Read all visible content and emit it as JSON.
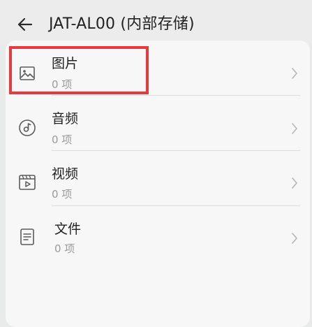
{
  "header": {
    "title": "JAT-AL00 (内部存储)"
  },
  "items": [
    {
      "label": "图片",
      "count": "0 项",
      "icon": "image-icon"
    },
    {
      "label": "音频",
      "count": "0 项",
      "icon": "music-icon"
    },
    {
      "label": "视频",
      "count": "0 项",
      "icon": "video-icon"
    },
    {
      "label": "文件",
      "count": "0 项",
      "icon": "document-icon"
    }
  ],
  "colors": {
    "highlight": "#e63a3f",
    "background": "#e9eaea",
    "card": "#f7f7f7"
  }
}
